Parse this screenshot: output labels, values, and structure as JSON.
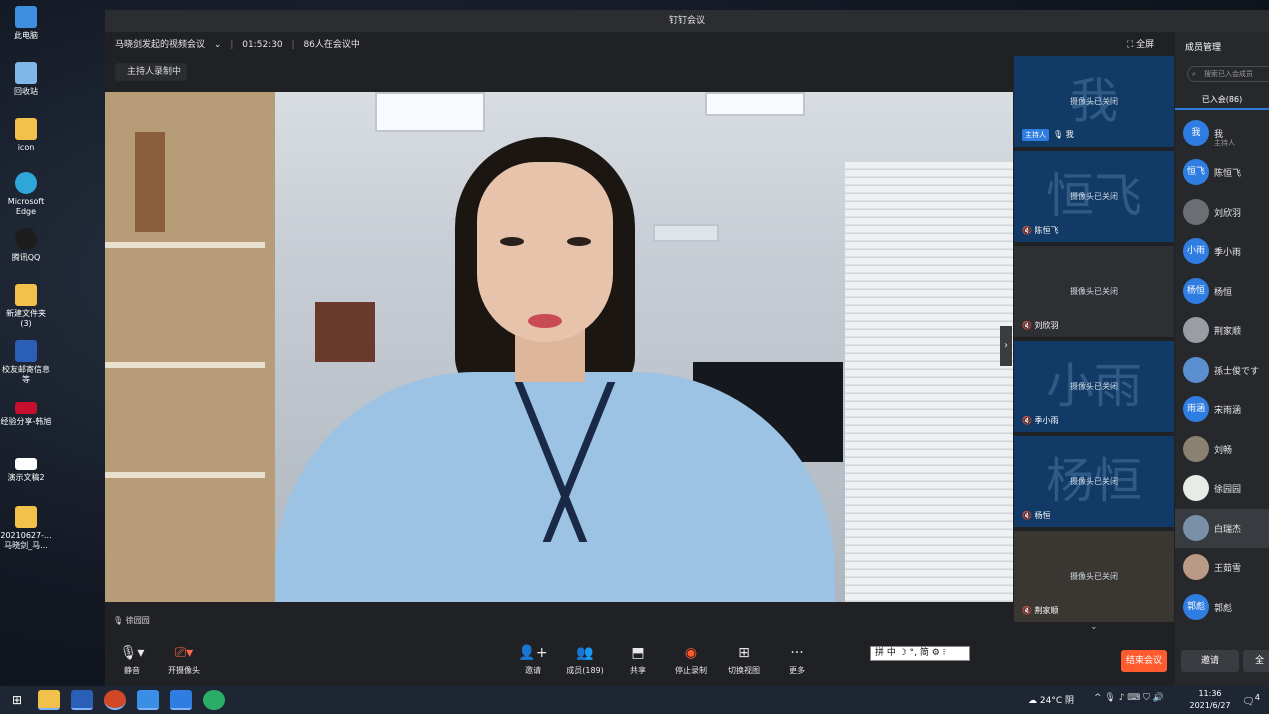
{
  "desktop": {
    "icons": [
      {
        "label": "此电脑",
        "color": "#3f8fe0"
      },
      {
        "label": "回收站",
        "color": "#7fb8e8"
      },
      {
        "label": "icon",
        "color": "#f2c14b"
      },
      {
        "label": "Microsoft Edge",
        "color": "#2fa6d9"
      },
      {
        "label": "腾讯QQ",
        "color": "#1d1d1d"
      },
      {
        "label": "新建文件夹 (3)",
        "color": "#f2c14b"
      },
      {
        "label": "校友邮寄信息等",
        "color": "#2b5eb6"
      },
      {
        "label": "经验分享-韩旭",
        "color": "#c8102e"
      },
      {
        "label": "演示文稿2",
        "color": "#ffffff"
      },
      {
        "label": "20210627-...马晓剑_马...",
        "color": "#f2c14b"
      }
    ]
  },
  "window": {
    "title": "钉钉会议",
    "meeting_name": "马晓剑发起的视频会议",
    "duration": "01:52:30",
    "participants_text": "86人在会议中",
    "fullscreen_label": "全屏",
    "recording_tag": "主持人录制中"
  },
  "main_video": {
    "speaker": "徐园园"
  },
  "thumbnails": [
    {
      "big": "我",
      "camera": "摄像头已关闭",
      "name": "我",
      "host_badge": "主持人"
    },
    {
      "big": "恒飞",
      "camera": "摄像头已关闭",
      "name": "陈恒飞"
    },
    {
      "big": "",
      "camera": "摄像头已关闭",
      "name": "刘欣羽"
    },
    {
      "big": "小雨",
      "camera": "摄像头已关闭",
      "name": "季小雨"
    },
    {
      "big": "杨恒",
      "camera": "摄像头已关闭",
      "name": "杨恒"
    },
    {
      "big": "",
      "camera": "摄像头已关闭",
      "name": "荆家顺"
    }
  ],
  "members": {
    "title": "成员管理",
    "search_placeholder": "搜索已入会成员",
    "tab": "已入会(86)",
    "list": [
      {
        "avatar": "我",
        "name": "我",
        "sub": "主持人",
        "color": "#2f7de1"
      },
      {
        "avatar": "恒飞",
        "name": "陈恒飞",
        "sub": "",
        "color": "#2f7de1"
      },
      {
        "avatar": "",
        "name": "刘欣羽",
        "sub": "",
        "color": "#6b6e73"
      },
      {
        "avatar": "小雨",
        "name": "季小雨",
        "sub": "",
        "color": "#2f7de1"
      },
      {
        "avatar": "杨恒",
        "name": "杨恒",
        "sub": "",
        "color": "#2f7de1"
      },
      {
        "avatar": "",
        "name": "荆家顺",
        "sub": "",
        "color": "#9a9ea4"
      },
      {
        "avatar": "",
        "name": "孫士俊です",
        "sub": "",
        "color": "#5b8fd0"
      },
      {
        "avatar": "雨涵",
        "name": "宋雨涵",
        "sub": "",
        "color": "#2f7de1"
      },
      {
        "avatar": "",
        "name": "刘畅",
        "sub": "",
        "color": "#8a8170"
      },
      {
        "avatar": "",
        "name": "徐园园",
        "sub": "",
        "color": "#e8ece6"
      },
      {
        "avatar": "",
        "name": "白瑞杰",
        "sub": "",
        "color": "#7a8fa8"
      },
      {
        "avatar": "",
        "name": "王茹雪",
        "sub": "",
        "color": "#b89a86"
      },
      {
        "avatar": "郭彪",
        "name": "郭彪",
        "sub": "",
        "color": "#2f7de1"
      }
    ],
    "invite_label": "邀请",
    "all_label": "全"
  },
  "toolbar": {
    "mute": "静音",
    "camera": "开摄像头",
    "invite": "邀请",
    "members": "成员(189)",
    "share": "共享",
    "stop_record": "停止录制",
    "switch_view": "切换视图",
    "more": "更多",
    "ime": "拼 中 ☽ °, 简 ⚙ ⁝",
    "end_meeting": "结束会议"
  },
  "taskbar": {
    "weather": "24°C 阴",
    "time": "11:36",
    "date": "2021/6/27",
    "notifications": "4"
  }
}
